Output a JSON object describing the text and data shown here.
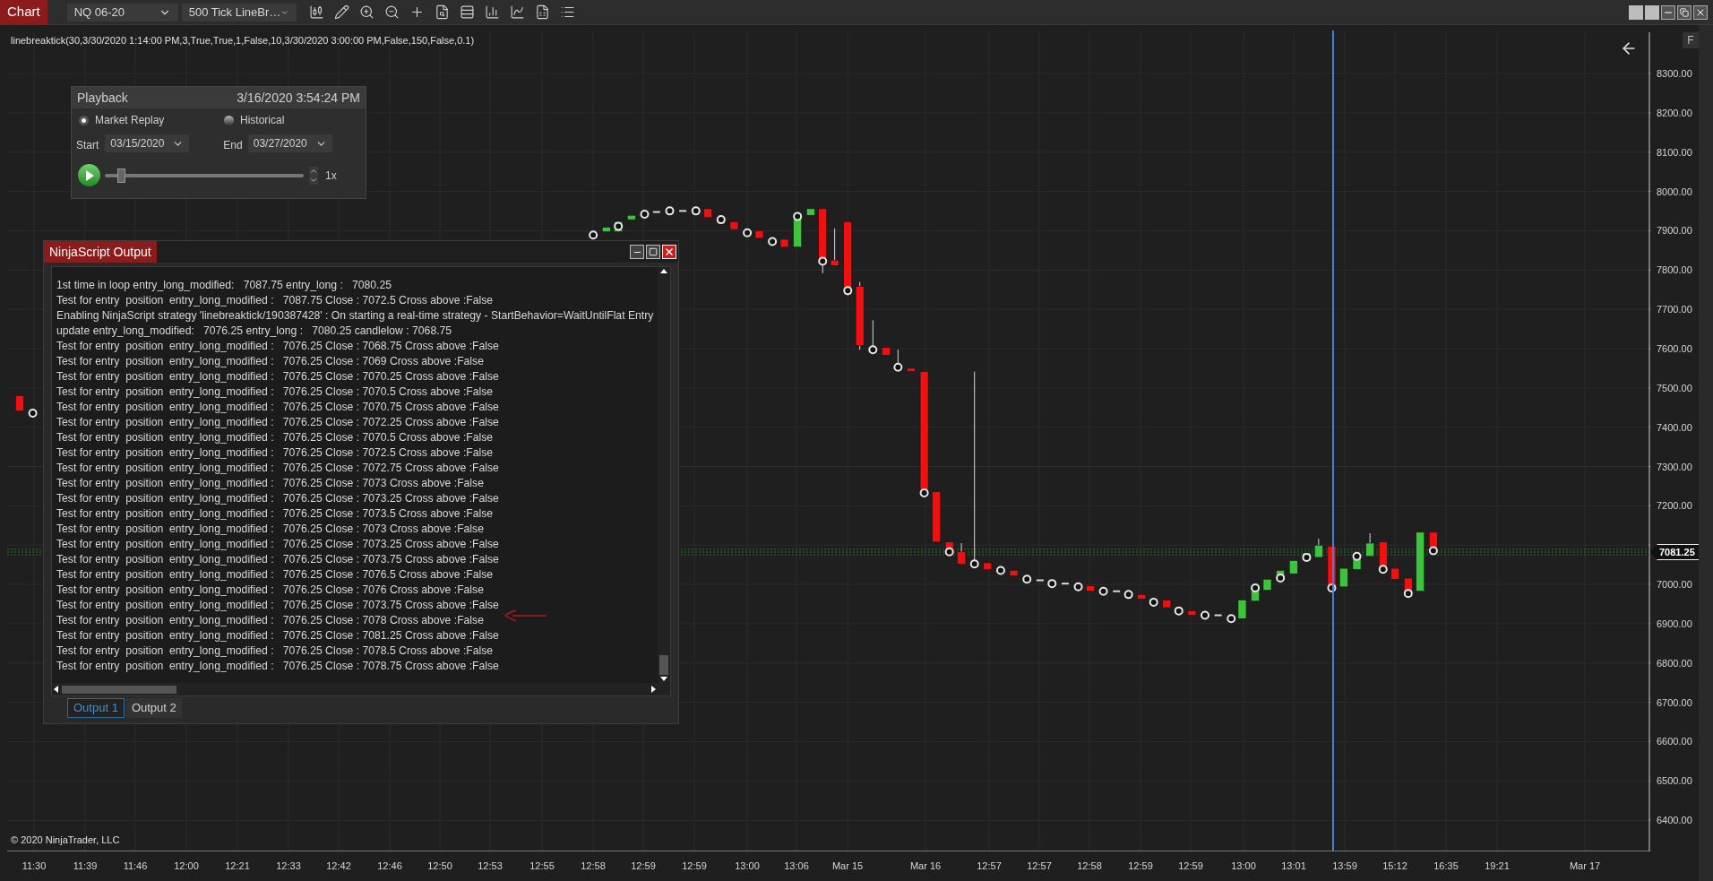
{
  "toolbar": {
    "chart_tab": "Chart",
    "instrument": "NQ 06-20",
    "interval": "500 Tick LineBr…"
  },
  "indicator_label": "linebreaktick(30,3/30/2020 1:14:00 PM,3,True,True,1,False,10,3/30/2020 3:00:00 PM,False,150,False,0.1)",
  "price_axis": {
    "labels": [
      "8300.00",
      "8200.00",
      "8100.00",
      "8000.00",
      "7900.00",
      "7800.00",
      "7700.00",
      "7600.00",
      "7500.00",
      "7400.00",
      "7300.00",
      "7200.00",
      "7000.00",
      "6900.00",
      "6800.00",
      "6700.00",
      "6600.00",
      "6500.00",
      "6400.00"
    ],
    "current_price": "7081.25",
    "flag": "F"
  },
  "time_axis": {
    "labels": [
      "11:30",
      "11:39",
      "11:46",
      "12:00",
      "12:21",
      "12:33",
      "12:42",
      "12:46",
      "12:50",
      "12:53",
      "12:55",
      "12:58",
      "12:59",
      "12:59",
      "13:00",
      "13:06",
      "Mar 15",
      "Mar 16",
      "12:57",
      "12:57",
      "12:58",
      "12:59",
      "12:59",
      "13:00",
      "13:01",
      "13:59",
      "15:12",
      "16:35",
      "19:21",
      "Mar 17"
    ]
  },
  "copyright": "© 2020 NinjaTrader, LLC",
  "playback": {
    "title": "Playback",
    "datetime": "3/16/2020 3:54:24 PM",
    "modes": [
      {
        "label": "Market Replay",
        "selected": true
      },
      {
        "label": "Historical",
        "selected": false
      }
    ],
    "start_label": "Start",
    "start_date": "03/15/2020",
    "end_label": "End",
    "end_date": "03/27/2020",
    "speed": "1x",
    "level": 0.08
  },
  "output_window": {
    "title": "NinjaScript Output",
    "lines": [
      "1st time in loop entry_long_modified:   7087.75 entry_long :   7080.25",
      "Test for entry  position  entry_long_modified :   7087.75 Close : 7072.5 Cross above :False",
      "Enabling NinjaScript strategy 'linebreaktick/190387428' : On starting a real-time strategy - StartBehavior=WaitUntilFlat Entry",
      "update entry_long_modified:   7076.25 entry_long :   7080.25 candlelow : 7068.75",
      "Test for entry  position  entry_long_modified :   7076.25 Close : 7068.75 Cross above :False",
      "Test for entry  position  entry_long_modified :   7076.25 Close : 7069 Cross above :False",
      "Test for entry  position  entry_long_modified :   7076.25 Close : 7070.25 Cross above :False",
      "Test for entry  position  entry_long_modified :   7076.25 Close : 7070.5 Cross above :False",
      "Test for entry  position  entry_long_modified :   7076.25 Close : 7070.75 Cross above :False",
      "Test for entry  position  entry_long_modified :   7076.25 Close : 7072.25 Cross above :False",
      "Test for entry  position  entry_long_modified :   7076.25 Close : 7070.5 Cross above :False",
      "Test for entry  position  entry_long_modified :   7076.25 Close : 7072.5 Cross above :False",
      "Test for entry  position  entry_long_modified :   7076.25 Close : 7072.75 Cross above :False",
      "Test for entry  position  entry_long_modified :   7076.25 Close : 7073 Cross above :False",
      "Test for entry  position  entry_long_modified :   7076.25 Close : 7073.25 Cross above :False",
      "Test for entry  position  entry_long_modified :   7076.25 Close : 7073.5 Cross above :False",
      "Test for entry  position  entry_long_modified :   7076.25 Close : 7073 Cross above :False",
      "Test for entry  position  entry_long_modified :   7076.25 Close : 7073.25 Cross above :False",
      "Test for entry  position  entry_long_modified :   7076.25 Close : 7073.75 Cross above :False",
      "Test for entry  position  entry_long_modified :   7076.25 Close : 7076.5 Cross above :False",
      "Test for entry  position  entry_long_modified :   7076.25 Close : 7076 Cross above :False",
      "Test for entry  position  entry_long_modified :   7076.25 Close : 7073.75 Cross above :False",
      "Test for entry  position  entry_long_modified :   7076.25 Close : 7078 Cross above :False",
      "Test for entry  position  entry_long_modified :   7076.25 Close : 7081.25 Cross above :False",
      "Test for entry  position  entry_long_modified :   7076.25 Close : 7078.5 Cross above :False",
      "Test for entry  position  entry_long_modified :   7076.25 Close : 7078.75 Cross above :False"
    ],
    "tabs": [
      {
        "label": "Output 1",
        "selected": true
      },
      {
        "label": "Output 2",
        "selected": false
      }
    ]
  }
}
